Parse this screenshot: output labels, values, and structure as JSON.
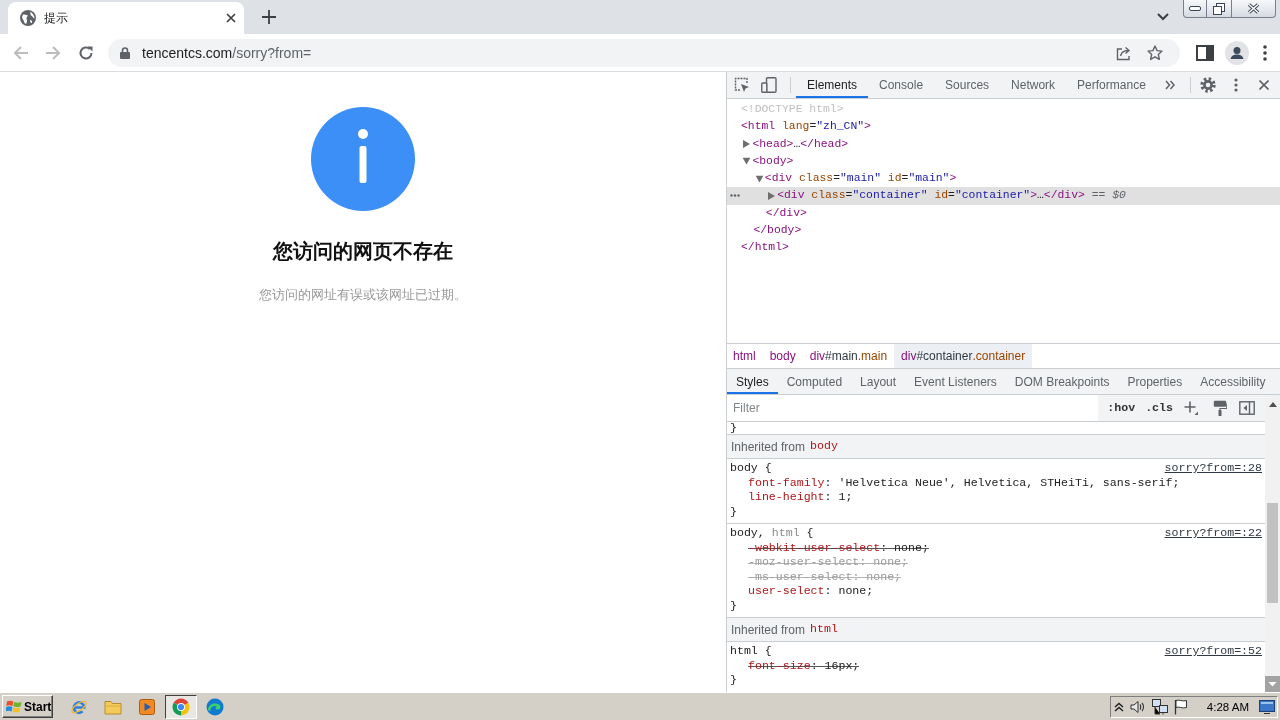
{
  "browser": {
    "tabs": [
      {
        "title": "提示",
        "selected": true
      }
    ],
    "toolbar": {
      "back": {
        "disabled": true
      },
      "forward": {
        "disabled": true
      }
    },
    "url": {
      "host": "tencentcs.com",
      "path": "/sorry?from="
    }
  },
  "page": {
    "heading": "您访问的网页不存在",
    "message": "您访问的网址有误或该网址已过期。"
  },
  "devtools": {
    "tabs": [
      {
        "label": "Elements",
        "selected": true
      },
      {
        "label": "Console",
        "selected": false
      },
      {
        "label": "Sources",
        "selected": false
      },
      {
        "label": "Network",
        "selected": false
      },
      {
        "label": "Performance",
        "selected": false
      }
    ],
    "dom_tree": [
      {
        "segments": [
          {
            "kind": "doctype",
            "text": "<!DOCTYPE html>"
          }
        ],
        "selected": false
      },
      {
        "segments": [
          {
            "kind": "tag",
            "text": "<html"
          },
          {
            "kind": "attr_name",
            "text": " lang"
          },
          {
            "kind": "text",
            "text": "="
          },
          {
            "kind": "attr_value",
            "text": "\"zh_CN\""
          },
          {
            "kind": "tag",
            "text": ">"
          }
        ],
        "selected": false,
        "children": [
          {
            "segments": [
              {
                "kind": "tag",
                "text": "<head>"
              },
              {
                "kind": "text",
                "text": "…"
              },
              {
                "kind": "tag",
                "text": "</head>"
              }
            ],
            "expanded": false,
            "selected": false
          },
          {
            "segments": [
              {
                "kind": "tag",
                "text": "<body>"
              }
            ],
            "expanded": true,
            "selected": false,
            "children": [
              {
                "segments": [
                  {
                    "kind": "tag",
                    "text": "<div"
                  },
                  {
                    "kind": "attr_name",
                    "text": " class"
                  },
                  {
                    "kind": "text",
                    "text": "="
                  },
                  {
                    "kind": "attr_value",
                    "text": "\"main\""
                  },
                  {
                    "kind": "attr_name",
                    "text": " id"
                  },
                  {
                    "kind": "text",
                    "text": "="
                  },
                  {
                    "kind": "attr_value",
                    "text": "\"main\""
                  },
                  {
                    "kind": "tag",
                    "text": ">"
                  }
                ],
                "expanded": true,
                "selected": false,
                "children": [
                  {
                    "segments": [
                      {
                        "kind": "tag",
                        "text": "<div"
                      },
                      {
                        "kind": "attr_name",
                        "text": " class"
                      },
                      {
                        "kind": "text",
                        "text": "="
                      },
                      {
                        "kind": "attr_value",
                        "text": "\"container\""
                      },
                      {
                        "kind": "attr_name",
                        "text": " id"
                      },
                      {
                        "kind": "text",
                        "text": "="
                      },
                      {
                        "kind": "attr_value",
                        "text": "\"container\""
                      },
                      {
                        "kind": "tag",
                        "text": ">"
                      },
                      {
                        "kind": "text",
                        "text": "…"
                      },
                      {
                        "kind": "tag",
                        "text": "</div>"
                      },
                      {
                        "kind": "marker",
                        "text": " == $0"
                      }
                    ],
                    "expanded": false,
                    "selected": true
                  }
                ],
                "closing": [
                  {
                    "kind": "tag",
                    "text": "</div>"
                  }
                ]
              }
            ],
            "closing": [
              {
                "kind": "tag",
                "text": "</body>"
              }
            ]
          }
        ],
        "closing": [
          {
            "kind": "tag",
            "text": "</html>"
          }
        ]
      }
    ],
    "breadcrumbs": [
      {
        "segments": [
          {
            "kind": "tag",
            "text": "html"
          }
        ],
        "selected": false
      },
      {
        "segments": [
          {
            "kind": "tag",
            "text": "body"
          }
        ],
        "selected": false
      },
      {
        "segments": [
          {
            "kind": "tag",
            "text": "div"
          },
          {
            "kind": "id",
            "text": "#main"
          },
          {
            "kind": "class",
            "text": ".main"
          }
        ],
        "selected": false
      },
      {
        "segments": [
          {
            "kind": "tag",
            "text": "div"
          },
          {
            "kind": "id",
            "text": "#container"
          },
          {
            "kind": "class",
            "text": ".container"
          }
        ],
        "selected": true
      }
    ],
    "sidebar_tabs": [
      {
        "label": "Styles",
        "selected": true
      },
      {
        "label": "Computed",
        "selected": false
      },
      {
        "label": "Layout",
        "selected": false
      },
      {
        "label": "Event Listeners",
        "selected": false
      },
      {
        "label": "DOM Breakpoints",
        "selected": false
      },
      {
        "label": "Properties",
        "selected": false
      },
      {
        "label": "Accessibility",
        "selected": false
      }
    ],
    "styles": {
      "filter": {
        "placeholder": "Filter"
      },
      "toggles": [
        ":hov",
        ".cls"
      ],
      "sections": [
        {
          "kind": "brace",
          "text": "}"
        },
        {
          "kind": "inherited",
          "label": "Inherited from",
          "element": "body"
        },
        {
          "kind": "rule",
          "selector": [
            {
              "kind": "matched",
              "text": "body"
            },
            {
              "kind": "text",
              "text": " {"
            }
          ],
          "source": "sorry?from=:28",
          "declarations": [
            {
              "kind": "active",
              "segments": [
                {
                  "kind": "prop",
                  "text": "font-family"
                },
                {
                  "kind": "text",
                  "text": ": 'Helvetica Neue', Helvetica, STHeiTi, sans-serif;"
                }
              ]
            },
            {
              "kind": "active",
              "segments": [
                {
                  "kind": "prop",
                  "text": "line-height"
                },
                {
                  "kind": "text",
                  "text": ": 1;"
                }
              ]
            }
          ],
          "closing": "}"
        },
        {
          "kind": "rule",
          "selector": [
            {
              "kind": "matched",
              "text": "body"
            },
            {
              "kind": "text",
              "text": ", "
            },
            {
              "kind": "unmatched",
              "text": "html"
            },
            {
              "kind": "text",
              "text": " {"
            }
          ],
          "source": "sorry?from=:22",
          "declarations": [
            {
              "kind": "overridden",
              "segments": [
                {
                  "kind": "prop",
                  "text": "-webkit-user-select"
                },
                {
                  "kind": "text",
                  "text": ": none;"
                }
              ]
            },
            {
              "kind": "invalid",
              "segments": [
                {
                  "kind": "prop",
                  "text": "-moz-user-select"
                },
                {
                  "kind": "text",
                  "text": ": none;"
                }
              ]
            },
            {
              "kind": "invalid",
              "segments": [
                {
                  "kind": "prop",
                  "text": "-ms-user-select"
                },
                {
                  "kind": "text",
                  "text": ": none;"
                }
              ]
            },
            {
              "kind": "active",
              "segments": [
                {
                  "kind": "prop",
                  "text": "user-select"
                },
                {
                  "kind": "text",
                  "text": ": none;"
                }
              ]
            }
          ],
          "closing": "}"
        },
        {
          "kind": "inherited",
          "label": "Inherited from",
          "element": "html"
        },
        {
          "kind": "rule",
          "selector": [
            {
              "kind": "matched",
              "text": "html"
            },
            {
              "kind": "text",
              "text": " {"
            }
          ],
          "source": "sorry?from=:52",
          "declarations": [
            {
              "kind": "overridden",
              "segments": [
                {
                  "kind": "prop",
                  "text": "font-size"
                },
                {
                  "kind": "text",
                  "text": ": 16px;"
                }
              ]
            }
          ],
          "closing": "}"
        }
      ]
    }
  },
  "taskbar": {
    "start": "Start",
    "apps": [
      {
        "kind": "ie",
        "selected": false
      },
      {
        "kind": "folder",
        "selected": false
      },
      {
        "kind": "media",
        "selected": false
      },
      {
        "kind": "chrome",
        "selected": true
      },
      {
        "kind": "edge",
        "selected": false
      }
    ],
    "clock": "4:28 AM"
  }
}
